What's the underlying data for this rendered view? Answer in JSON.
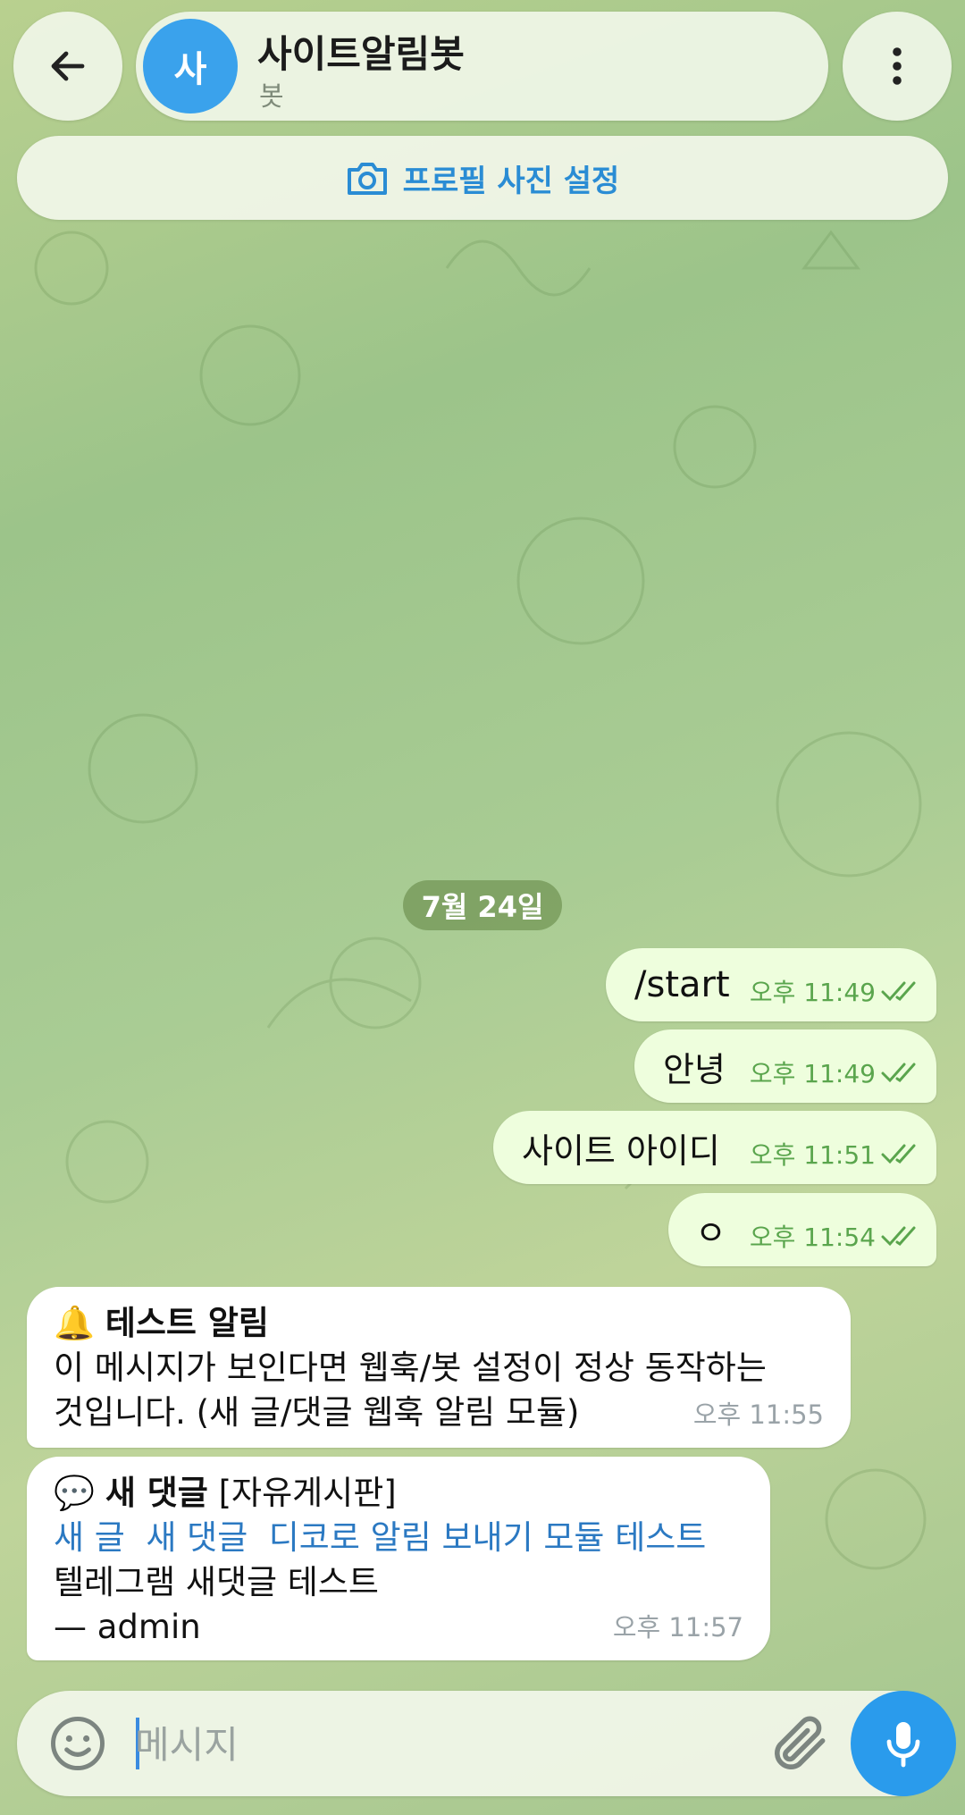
{
  "header": {
    "back_icon": "arrow-left-icon",
    "avatar_letter": "사",
    "chat_name": "사이트알림봇",
    "chat_subtitle": "봇",
    "more_icon": "more-vertical-icon"
  },
  "profile_prompt": {
    "icon": "camera-icon",
    "label": "프로필 사진 설정"
  },
  "date_separator": "7월 24일",
  "outgoing": [
    {
      "text": "/start",
      "time": "오후 11:49",
      "is_command": true
    },
    {
      "text": "안녕",
      "time": "오후 11:49"
    },
    {
      "text": "사이트 아이디",
      "time": "오후 11:51"
    },
    {
      "text": "ㅇ",
      "time": "오후 11:54"
    }
  ],
  "incoming": [
    {
      "emoji": "🔔",
      "title": "테스트 알림",
      "line1": "이 메시지가 보인다면 웹훅/봇 설정이 정상 동작하는",
      "line2": "것입니다. (새 글/댓글 웹훅 알림 모듈)",
      "time": "오후 11:55"
    },
    {
      "emoji": "💬",
      "title": "새 댓글",
      "board": "[자유게시판]",
      "link": "새 글  새 댓글  디코로 알림 보내기 모듈 테스트",
      "line2": "텔레그램 새댓글 테스트",
      "line3": "— admin",
      "time": "오후 11:57"
    }
  ],
  "composer": {
    "placeholder": "메시지",
    "emoji_icon": "smiley-icon",
    "attach_icon": "paperclip-icon",
    "mic_icon": "microphone-icon"
  },
  "colors": {
    "accent": "#2a9bec",
    "outgoing_bubble": "#eefedd",
    "check_color": "#5aa54d",
    "link": "#2b79c2"
  }
}
